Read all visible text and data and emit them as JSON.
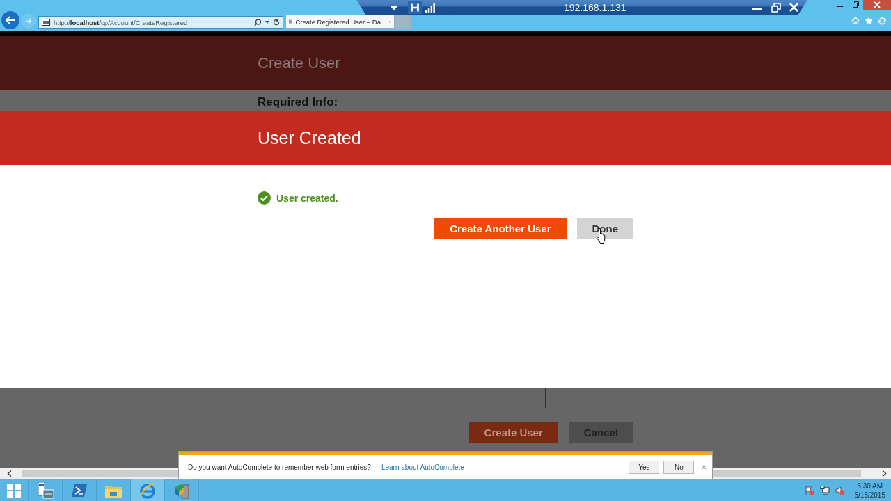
{
  "browser": {
    "address": "http://**localhost**/cp/Account/CreateRegistered",
    "tabs": [
      {
        "title": "Create Registered User – Da...",
        "selected": true
      }
    ]
  },
  "remote_bar": {
    "host": "192.168.1.131"
  },
  "page": {
    "title": "Create User",
    "section": "Required Info:",
    "buttons": [
      {
        "label": "Create User",
        "kind": "primary"
      },
      {
        "label": "Cancel",
        "kind": "secondary"
      }
    ]
  },
  "dialog": {
    "title": "User Created",
    "message": "User created.",
    "buttons": [
      {
        "label": "Create Another User",
        "kind": "primary"
      },
      {
        "label": "Done",
        "kind": "secondary"
      }
    ]
  },
  "notification": {
    "message": "Do you want AutoComplete to remember web form entries?",
    "link": "Learn about AutoComplete",
    "buttons": [
      "Yes",
      "No"
    ],
    "close": "×"
  },
  "taskbar": {
    "time": "5:30 AM",
    "date": "5/18/2015"
  }
}
